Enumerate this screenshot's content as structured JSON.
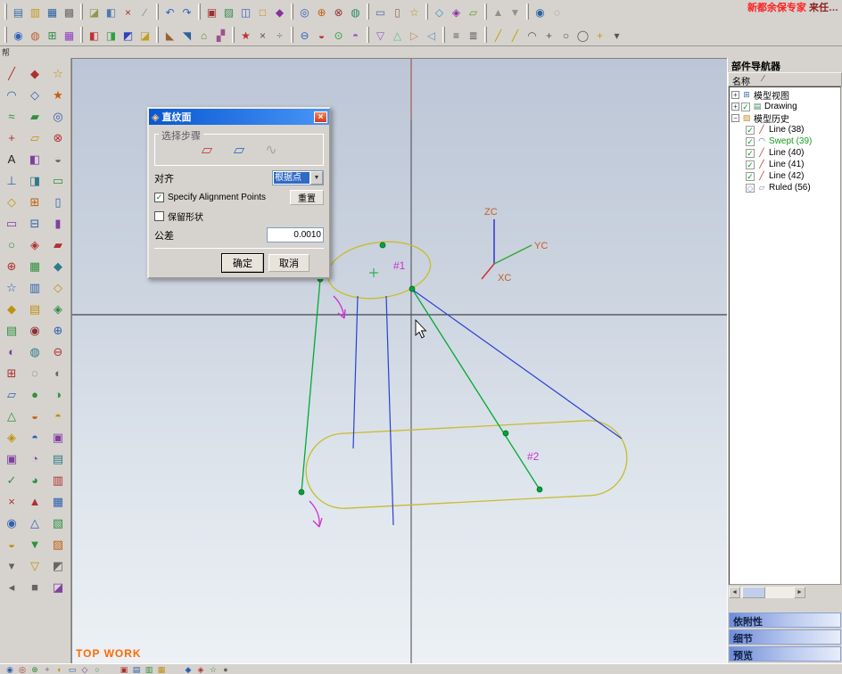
{
  "chrome": {
    "ad_part1": "新都余保专家",
    "ad_part2": " 来任…",
    "ad_color1": "#ff2020",
    "ad_color2": "#902020",
    "dock_label": "帮"
  },
  "dialog": {
    "title": "直纹面",
    "icon_glyph": "◈",
    "close_glyph": "×",
    "selection_steps_label": "选择步骤",
    "step1_glyph": "▱",
    "step2_glyph": "▱",
    "step3_glyph": "∿",
    "align_label": "对齐",
    "align_value": "根据点",
    "combo_arrow": "▼",
    "specify_alignment": "Specify Alignment Points",
    "specify_check": "✓",
    "reset_button": "重置",
    "preserve_shape": "保留形状",
    "tolerance_label": "公差",
    "tolerance_value": "0.0010",
    "ok_button": "确定",
    "cancel_button": "取消"
  },
  "viewport": {
    "label1": "#1",
    "label2": "#2",
    "axis_zc": "ZC",
    "axis_yc": "YC",
    "axis_xc": "XC",
    "status": "TOP WORK"
  },
  "navigator": {
    "title": "部件导航器",
    "column_name": "名称",
    "sort_glyph": "∕",
    "scroll_left": "◄",
    "scroll_right": "►",
    "tree": [
      {
        "expander": "+",
        "check": "",
        "icon": "⊞",
        "label": "模型视图"
      },
      {
        "expander": "+",
        "check": "✓",
        "icon": "▤",
        "label": "Drawing"
      },
      {
        "expander": "−",
        "check": "",
        "icon": "▨",
        "label": "模型历史"
      },
      {
        "expander": "",
        "check": "✓",
        "icon": "╱",
        "label": "Line (38)"
      },
      {
        "expander": "",
        "check": "✓",
        "icon": "◠",
        "label": "Swept (39)"
      },
      {
        "expander": "",
        "check": "✓",
        "icon": "╱",
        "label": "Line (40)"
      },
      {
        "expander": "",
        "check": "✓",
        "icon": "╱",
        "label": "Line (41)"
      },
      {
        "expander": "",
        "check": "✓",
        "icon": "╱",
        "label": "Line (42)"
      },
      {
        "expander": "",
        "check": "◇",
        "icon": "▱",
        "label": "Ruled (56)"
      }
    ],
    "tabs": [
      "依附性",
      "细节",
      "预览"
    ]
  },
  "toolbars": {
    "row1": [
      {
        "sep": true
      },
      {
        "name": "new-file-icon",
        "g": "▤",
        "c": "#3a6ea5"
      },
      {
        "name": "open-file-icon",
        "g": "▥",
        "c": "#c8941a"
      },
      {
        "name": "save-icon",
        "g": "▦",
        "c": "#2e62a0"
      },
      {
        "name": "print-icon",
        "g": "▩",
        "c": "#6a6a6a"
      },
      {
        "sep": true
      },
      {
        "g": "◪",
        "c": "#8a9a4a"
      },
      {
        "g": "◧",
        "c": "#4a7ab0"
      },
      {
        "name": "delete-icon",
        "g": "×",
        "c": "#b03030"
      },
      {
        "g": "∕",
        "c": "#888888"
      },
      {
        "sep": true
      },
      {
        "name": "undo-icon",
        "g": "↶",
        "c": "#3060c0"
      },
      {
        "name": "redo-icon",
        "g": "↷",
        "c": "#3060c0"
      },
      {
        "sep": true
      },
      {
        "g": "▣",
        "c": "#a03030"
      },
      {
        "g": "▨",
        "c": "#3a8a50"
      },
      {
        "g": "◫",
        "c": "#3060c0"
      },
      {
        "g": "□",
        "c": "#c09010"
      },
      {
        "g": "◆",
        "c": "#8a30a0"
      },
      {
        "sep": true
      },
      {
        "g": "◎",
        "c": "#3060c0"
      },
      {
        "g": "⊕",
        "c": "#c06010"
      },
      {
        "g": "⊗",
        "c": "#903030"
      },
      {
        "g": "◍",
        "c": "#2a8a6a"
      },
      {
        "sep": true
      },
      {
        "g": "▭",
        "c": "#5a6a9a"
      },
      {
        "g": "▯",
        "c": "#9a6a5a"
      },
      {
        "g": "☆",
        "c": "#c09010"
      },
      {
        "sep": true
      },
      {
        "g": "◇",
        "c": "#3090c0"
      },
      {
        "g": "◈",
        "c": "#9030a0"
      },
      {
        "g": "▱",
        "c": "#6a9a30"
      },
      {
        "sep": true
      },
      {
        "g": "▲",
        "c": "#909090"
      },
      {
        "g": "▼",
        "c": "#909090"
      },
      {
        "sep": true
      },
      {
        "g": "◉",
        "c": "#2e62a0"
      },
      {
        "g": "◌",
        "c": "#888888"
      }
    ],
    "row2": [
      {
        "sep": true
      },
      {
        "g": "◉",
        "c": "#3060c0"
      },
      {
        "g": "◍",
        "c": "#c06030"
      },
      {
        "g": "⊞",
        "c": "#309040"
      },
      {
        "g": "▦",
        "c": "#9040c0"
      },
      {
        "sep": true
      },
      {
        "g": "◧",
        "c": "#c03030"
      },
      {
        "g": "◨",
        "c": "#30a040"
      },
      {
        "g": "◩",
        "c": "#3040c0"
      },
      {
        "g": "◪",
        "c": "#c0a020"
      },
      {
        "sep": true
      },
      {
        "g": "◣",
        "c": "#9a6030"
      },
      {
        "g": "◥",
        "c": "#30609a"
      },
      {
        "g": "⌂",
        "c": "#609030"
      },
      {
        "g": "▞",
        "c": "#a05090"
      },
      {
        "sep": true
      },
      {
        "g": "★",
        "c": "#c03030"
      },
      {
        "g": "×",
        "c": "#555555"
      },
      {
        "g": "÷",
        "c": "#777777"
      },
      {
        "sep": true
      },
      {
        "g": "⊖",
        "c": "#3060c0"
      },
      {
        "g": "◒",
        "c": "#c03030"
      },
      {
        "g": "⊙",
        "c": "#30a040"
      },
      {
        "g": "◓",
        "c": "#9060c0"
      },
      {
        "sep": true
      },
      {
        "g": "▽",
        "c": "#9060c0"
      },
      {
        "g": "△",
        "c": "#60c090"
      },
      {
        "g": "▷",
        "c": "#c09060"
      },
      {
        "g": "◁",
        "c": "#6090c0"
      },
      {
        "sep": true
      },
      {
        "g": "≡",
        "c": "#555555"
      },
      {
        "g": "≣",
        "c": "#555555"
      },
      {
        "sep": true
      },
      {
        "name": "line-tool-icon",
        "g": "╱",
        "c": "#c0a000"
      },
      {
        "name": "line-tool-icon",
        "g": "╱",
        "c": "#c0a000"
      },
      {
        "name": "arc-tool-icon",
        "g": "◠",
        "c": "#555555"
      },
      {
        "name": "point-tool-icon",
        "g": "+",
        "c": "#555555"
      },
      {
        "name": "circle-tool-icon",
        "g": "○",
        "c": "#555555"
      },
      {
        "name": "circle-tool-icon",
        "g": "◯",
        "c": "#555555"
      },
      {
        "name": "line-tool-icon",
        "g": "+",
        "c": "#c0a000"
      },
      {
        "name": "chevron-down-icon",
        "g": "▾",
        "c": "#555555"
      }
    ],
    "left": [
      {
        "name": "line-tool-icon",
        "g": "╱",
        "c": "#b03030"
      },
      {
        "name": "arc-tool-icon",
        "g": "◠",
        "c": "#3060b0"
      },
      {
        "name": "spline-tool-icon",
        "g": "≈",
        "c": "#309040"
      },
      {
        "name": "point-tool-icon",
        "g": "+",
        "c": "#b03030"
      },
      {
        "name": "text-tool-icon",
        "g": "A",
        "c": "#202020"
      },
      {
        "g": "⊥",
        "c": "#3060b0"
      },
      {
        "g": "◇",
        "c": "#c09010"
      },
      {
        "g": "▭",
        "c": "#8040a0"
      },
      {
        "g": "○",
        "c": "#309040"
      },
      {
        "g": "⊕",
        "c": "#b03030"
      },
      {
        "g": "☆",
        "c": "#3060b0"
      },
      {
        "g": "◆",
        "c": "#c09010"
      },
      {
        "g": "▤",
        "c": "#309040"
      },
      {
        "g": "◐",
        "c": "#8040a0"
      },
      {
        "g": "⊞",
        "c": "#b03030"
      },
      {
        "g": "▱",
        "c": "#3060b0"
      },
      {
        "g": "△",
        "c": "#309040"
      },
      {
        "g": "◈",
        "c": "#c09010"
      },
      {
        "g": "▣",
        "c": "#8040a0"
      },
      {
        "g": "✓",
        "c": "#309040"
      },
      {
        "g": "×",
        "c": "#b03030"
      },
      {
        "g": "◉",
        "c": "#3060b0"
      },
      {
        "g": "◒",
        "c": "#c09010"
      },
      {
        "g": "▾",
        "c": "#606060"
      },
      {
        "g": "◂",
        "c": "#606060"
      },
      {
        "g": "◆",
        "c": "#b03030"
      },
      {
        "g": "◇",
        "c": "#3060b0"
      },
      {
        "g": "▰",
        "c": "#309040"
      },
      {
        "g": "▱",
        "c": "#c09010"
      },
      {
        "g": "◧",
        "c": "#8040a0"
      },
      {
        "g": "◨",
        "c": "#307a8a"
      },
      {
        "g": "⊞",
        "c": "#c06010"
      },
      {
        "g": "⊟",
        "c": "#3060b0"
      },
      {
        "g": "◈",
        "c": "#b03030"
      },
      {
        "g": "▦",
        "c": "#309040"
      },
      {
        "g": "▥",
        "c": "#3060b0"
      },
      {
        "g": "▤",
        "c": "#c09010"
      },
      {
        "g": "◉",
        "c": "#903030"
      },
      {
        "g": "◍",
        "c": "#307a8a"
      },
      {
        "g": "◌",
        "c": "#666666"
      },
      {
        "g": "●",
        "c": "#309040"
      },
      {
        "g": "◒",
        "c": "#c06010"
      },
      {
        "g": "◓",
        "c": "#3060b0"
      },
      {
        "g": "◔",
        "c": "#8040a0"
      },
      {
        "g": "◕",
        "c": "#309040"
      },
      {
        "g": "▲",
        "c": "#b03030"
      },
      {
        "g": "△",
        "c": "#3060b0"
      },
      {
        "g": "▼",
        "c": "#309040"
      },
      {
        "g": "▽",
        "c": "#c09010"
      },
      {
        "g": "■",
        "c": "#666666"
      },
      {
        "g": "☆",
        "c": "#c09010"
      },
      {
        "g": "★",
        "c": "#c06010"
      },
      {
        "g": "◎",
        "c": "#3060b0"
      },
      {
        "g": "⊗",
        "c": "#b03030"
      },
      {
        "g": "◒",
        "c": "#666666"
      },
      {
        "g": "▭",
        "c": "#309040"
      },
      {
        "g": "▯",
        "c": "#3060b0"
      },
      {
        "g": "▮",
        "c": "#8040a0"
      },
      {
        "g": "▰",
        "c": "#b03030"
      },
      {
        "g": "◆",
        "c": "#307a8a"
      },
      {
        "g": "◇",
        "c": "#c09010"
      },
      {
        "g": "◈",
        "c": "#309040"
      },
      {
        "g": "⊕",
        "c": "#3060b0"
      },
      {
        "g": "⊖",
        "c": "#b03030"
      },
      {
        "g": "◐",
        "c": "#666666"
      },
      {
        "g": "◑",
        "c": "#309040"
      },
      {
        "g": "◓",
        "c": "#c09010"
      },
      {
        "g": "▣",
        "c": "#8040a0"
      },
      {
        "g": "▤",
        "c": "#307a8a"
      },
      {
        "g": "▥",
        "c": "#b03030"
      },
      {
        "g": "▦",
        "c": "#3060b0"
      },
      {
        "g": "▧",
        "c": "#309040"
      },
      {
        "g": "▨",
        "c": "#c06010"
      },
      {
        "g": "◩",
        "c": "#666666"
      },
      {
        "g": "◪",
        "c": "#8040a0"
      }
    ],
    "bottom": [
      {
        "g": "◉",
        "c": "#3060b0"
      },
      {
        "g": "◎",
        "c": "#b03030"
      },
      {
        "g": "⊕",
        "c": "#309040"
      },
      {
        "g": "+",
        "c": "#666666"
      },
      {
        "g": "◐",
        "c": "#c09010"
      },
      {
        "g": "▭",
        "c": "#3060b0"
      },
      {
        "g": "◇",
        "c": "#8040a0"
      },
      {
        "g": "○",
        "c": "#309040"
      },
      {
        "gap": true
      },
      {
        "g": "▣",
        "c": "#b03030"
      },
      {
        "g": "▤",
        "c": "#3060b0"
      },
      {
        "g": "▥",
        "c": "#309040"
      },
      {
        "g": "▦",
        "c": "#c09010"
      },
      {
        "gap": true
      },
      {
        "g": "◆",
        "c": "#3060b0"
      },
      {
        "g": "◈",
        "c": "#b03030"
      },
      {
        "g": "☆",
        "c": "#309040"
      },
      {
        "g": "●",
        "c": "#666666"
      }
    ]
  }
}
